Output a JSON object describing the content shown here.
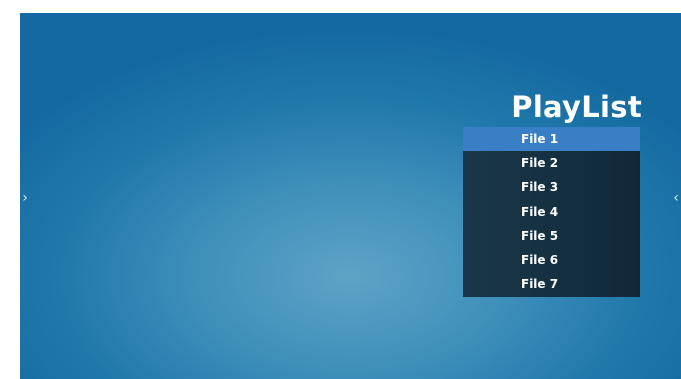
{
  "title": "PlayList",
  "nav": {
    "prev_glyph": "›",
    "next_glyph": "‹"
  },
  "playlist": {
    "selected_index": 0,
    "items": [
      "File 1",
      "File 2",
      "File 3",
      "File 4",
      "File 5",
      "File 6",
      "File 7"
    ]
  },
  "colors": {
    "background": "#1f78aa",
    "list_bg": "#142f40",
    "selected": "#3a7fc6",
    "text": "#ffffff"
  }
}
